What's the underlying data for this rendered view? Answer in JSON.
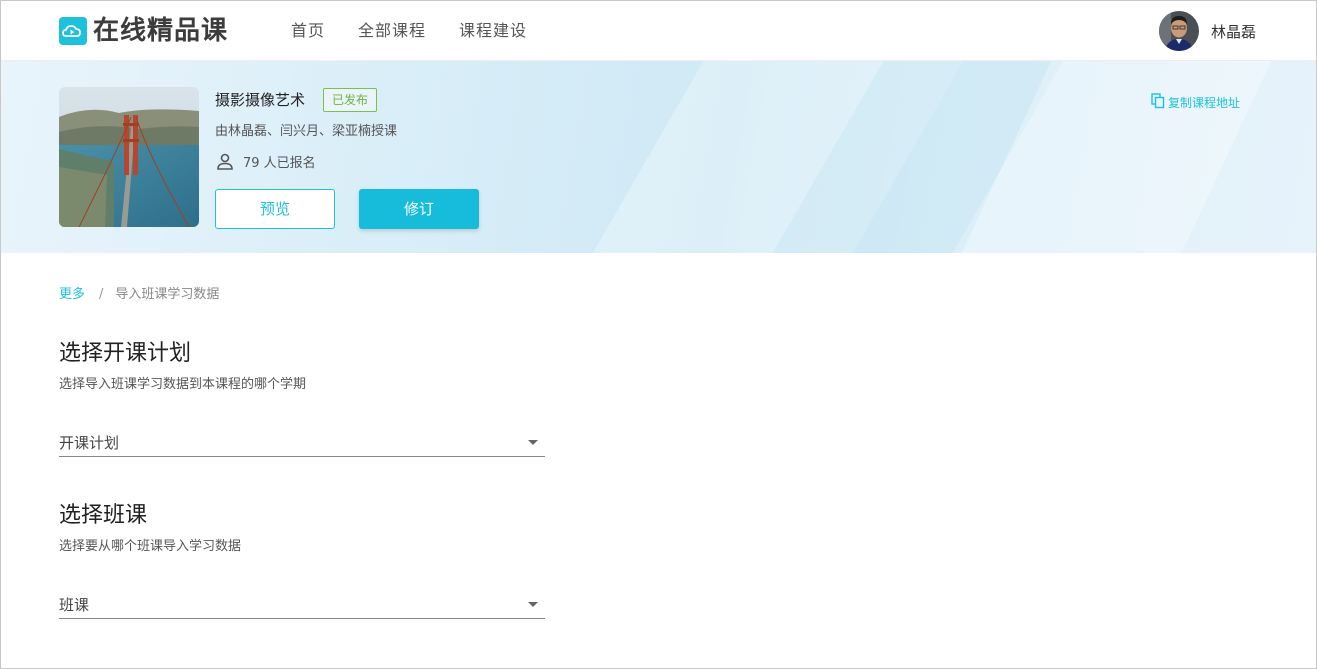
{
  "header": {
    "logo_text": "在线精品课",
    "nav": [
      {
        "label": "首页"
      },
      {
        "label": "全部课程"
      },
      {
        "label": "课程建设"
      }
    ],
    "user_name": "林晶磊"
  },
  "course": {
    "title": "摄影摄像艺术",
    "status": "已发布",
    "teachers": "由林晶磊、闫兴月、梁亚楠授课",
    "enrolled": "79 人已报名",
    "preview_label": "预览",
    "revise_label": "修订",
    "copy_link_label": "复制课程地址"
  },
  "breadcrumb": {
    "parent": "更多",
    "separator": "/",
    "current": "导入班课学习数据"
  },
  "plan_section": {
    "title": "选择开课计划",
    "subtitle": "选择导入班课学习数据到本课程的哪个学期",
    "select_placeholder": "开课计划"
  },
  "class_section": {
    "title": "选择班课",
    "subtitle": "选择要从哪个班课导入学习数据",
    "select_placeholder": "班课"
  },
  "colors": {
    "accent": "#1ec1dc",
    "published": "#6cb33e"
  }
}
